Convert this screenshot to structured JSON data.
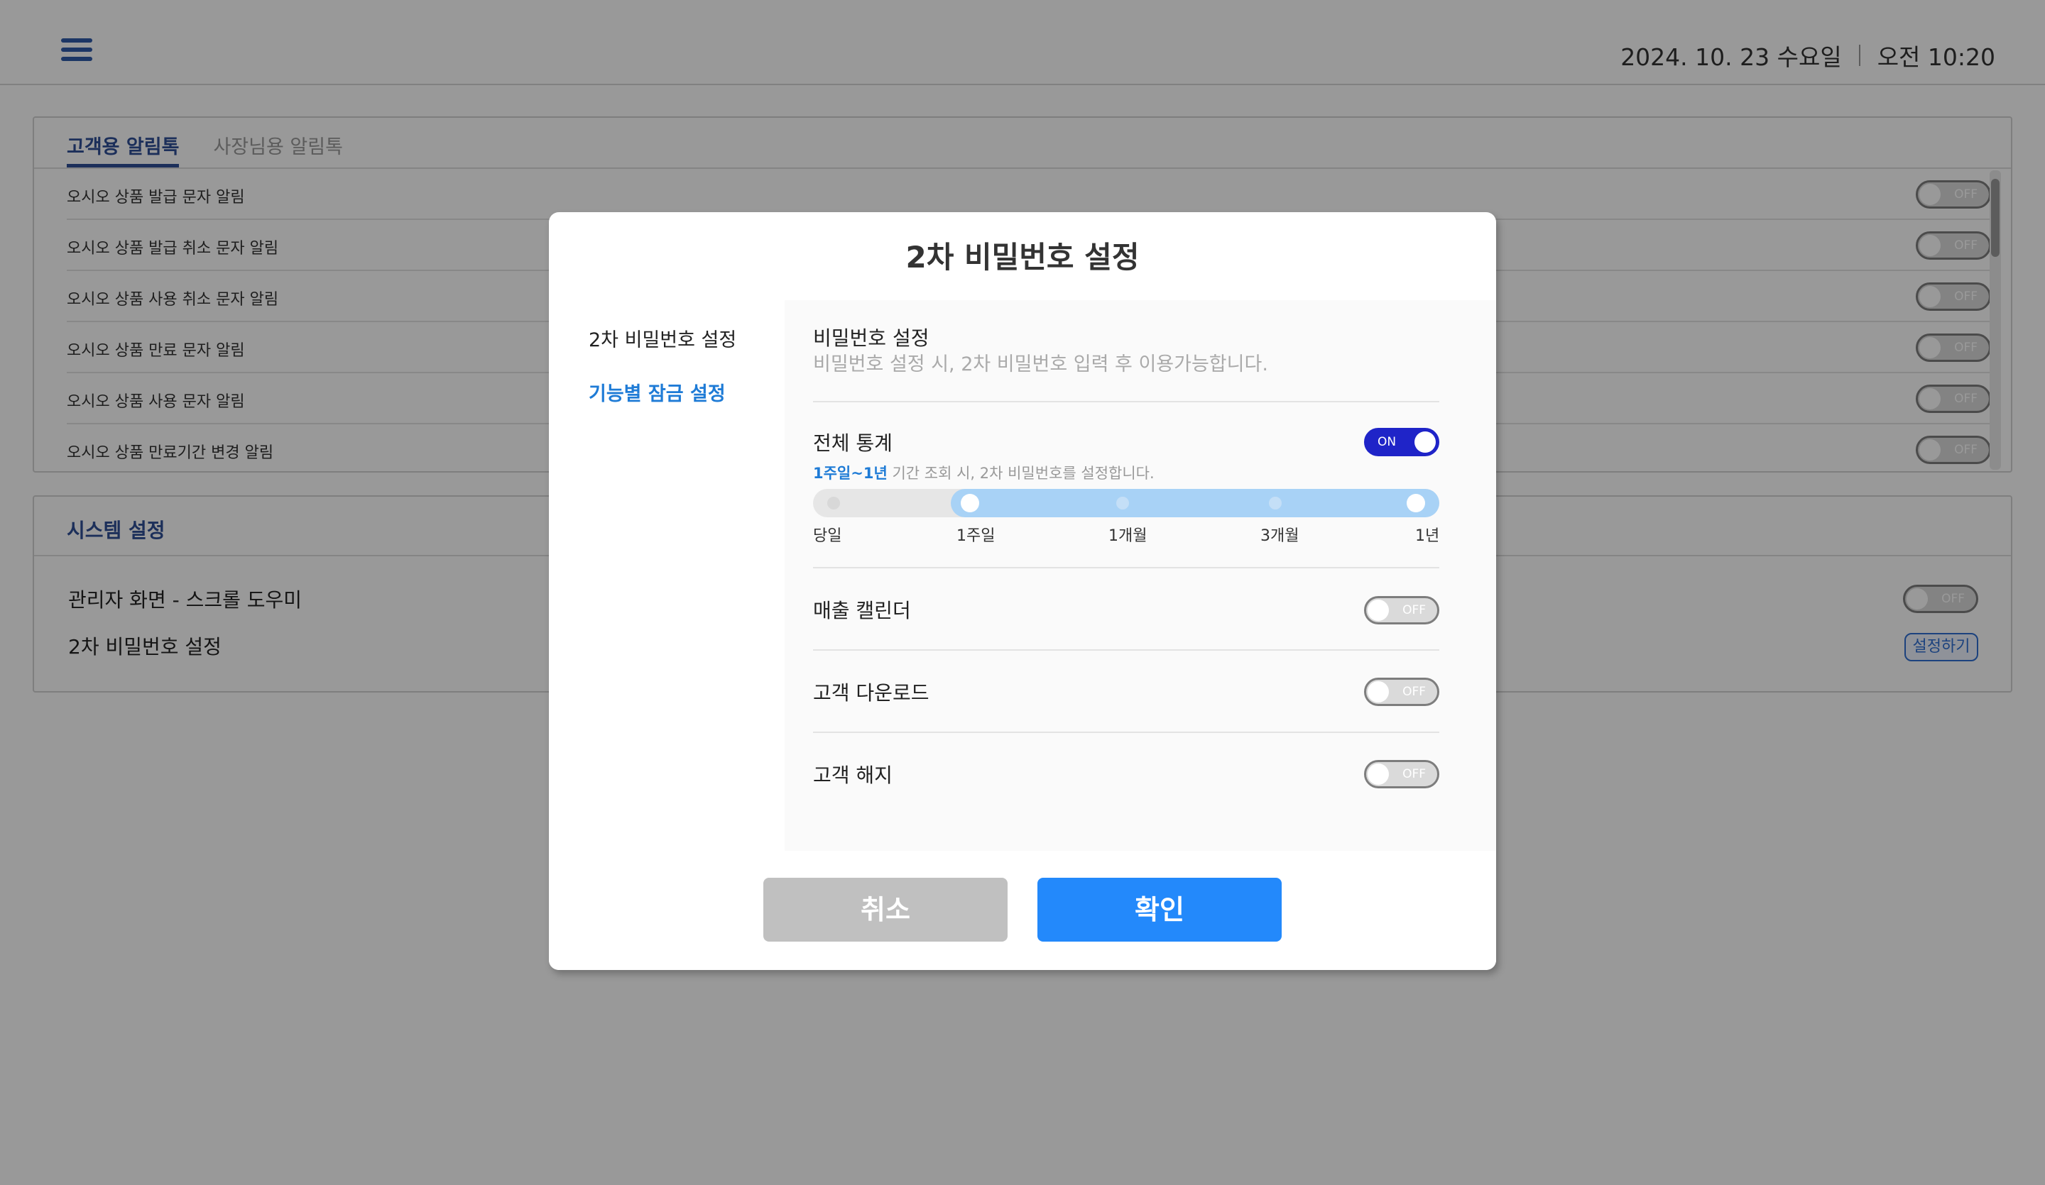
{
  "header": {
    "date": "2024. 10. 23 수요일",
    "time": "오전 10:20"
  },
  "alimtalk": {
    "tabs": [
      "고객용 알림톡",
      "사장님용 알림톡"
    ],
    "rows": [
      {
        "label": "오시오 상품 발급 문자 알림",
        "toggle": "OFF"
      },
      {
        "label": "오시오 상품 발급 취소 문자 알림",
        "toggle": "OFF"
      },
      {
        "label": "오시오 상품 사용 취소 문자 알림",
        "toggle": "OFF"
      },
      {
        "label": "오시오 상품 만료 문자 알림",
        "toggle": "OFF"
      },
      {
        "label": "오시오 상품 사용 문자 알림",
        "toggle": "OFF"
      },
      {
        "label": "오시오 상품 만료기간 변경 알림",
        "toggle": "OFF"
      }
    ]
  },
  "system": {
    "title": "시스템 설정",
    "row1_label": "관리자 화면 - 스크롤 도우미",
    "row1_toggle": "OFF",
    "row2_label": "2차 비밀번호 설정",
    "row2_button": "설정하기"
  },
  "modal": {
    "title": "2차 비밀번호 설정",
    "side": [
      "2차 비밀번호 설정",
      "기능별 잠금 설정"
    ],
    "password": {
      "title": "비밀번호 설정",
      "desc": "비밀번호 설정 시, 2차 비밀번호 입력 후 이용가능합니다."
    },
    "stats": {
      "title": "전체 통계",
      "toggle": "ON",
      "note_highlight": "1주일~1년",
      "note_rest": " 기간 조회 시, 2차 비밀번호를 설정합니다.",
      "slider_labels": [
        "당일",
        "1주일",
        "1개월",
        "3개월",
        "1년"
      ],
      "range_selected": [
        "1주일",
        "1년"
      ]
    },
    "calendar": {
      "title": "매출 캘린더",
      "toggle": "OFF"
    },
    "download": {
      "title": "고객 다운로드",
      "toggle": "OFF"
    },
    "cancel_customer": {
      "title": "고객 해지",
      "toggle": "OFF"
    },
    "buttons": {
      "cancel": "취소",
      "confirm": "확인"
    }
  },
  "colors": {
    "accent_blue": "#2389fb",
    "toggle_on": "#1f24c8",
    "nav_blue": "#2f4f96",
    "link_blue": "#1e7bd6"
  }
}
